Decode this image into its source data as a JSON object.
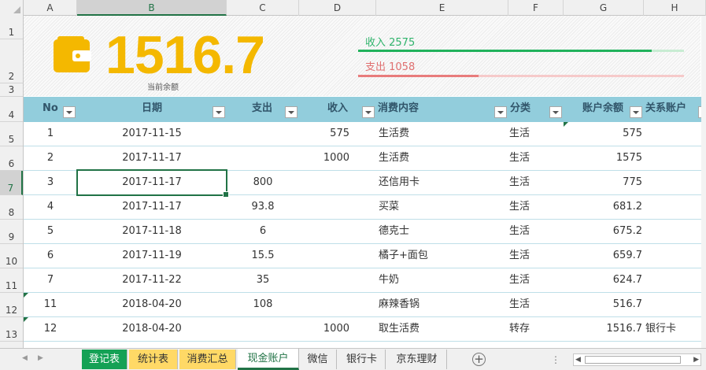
{
  "column_headers": [
    "A",
    "B",
    "C",
    "D",
    "E",
    "F",
    "G",
    "H"
  ],
  "row_headers": [
    "1",
    "2",
    "3",
    "4",
    "5",
    "6",
    "7",
    "8",
    "9",
    "10",
    "11",
    "12",
    "13"
  ],
  "dashboard": {
    "balance": "1516.7",
    "balance_label": "当前余额",
    "income_label": "收入 2575",
    "income_fraction": 0.9,
    "expense_label": "支出 1058",
    "expense_fraction": 0.37,
    "income_color": "#21b25c",
    "expense_color": "#e87c7c",
    "balance_color": "#f4b800"
  },
  "table": {
    "headers": [
      "No",
      "日期",
      "支出",
      "收入",
      "消费内容",
      "分类",
      "账户余额",
      "关系账户"
    ],
    "header_color": "#92cddc",
    "rows": [
      {
        "no": "1",
        "date": "2017-11-15",
        "expense": "",
        "income": "575",
        "content": "生活费",
        "category": "生活",
        "balance": "575",
        "account": ""
      },
      {
        "no": "2",
        "date": "2017-11-17",
        "expense": "",
        "income": "1000",
        "content": "生活费",
        "category": "生活",
        "balance": "1575",
        "account": ""
      },
      {
        "no": "3",
        "date": "2017-11-17",
        "expense": "800",
        "income": "",
        "content": "还信用卡",
        "category": "生活",
        "balance": "775",
        "account": ""
      },
      {
        "no": "4",
        "date": "2017-11-17",
        "expense": "93.8",
        "income": "",
        "content": "买菜",
        "category": "生活",
        "balance": "681.2",
        "account": ""
      },
      {
        "no": "5",
        "date": "2017-11-18",
        "expense": "6",
        "income": "",
        "content": "德克士",
        "category": "生活",
        "balance": "675.2",
        "account": ""
      },
      {
        "no": "6",
        "date": "2017-11-19",
        "expense": "15.5",
        "income": "",
        "content": "橘子+面包",
        "category": "生活",
        "balance": "659.7",
        "account": ""
      },
      {
        "no": "7",
        "date": "2017-11-22",
        "expense": "35",
        "income": "",
        "content": "牛奶",
        "category": "生活",
        "balance": "624.7",
        "account": ""
      },
      {
        "no": "11",
        "date": "2018-04-20",
        "expense": "108",
        "income": "",
        "content": "麻辣香锅",
        "category": "生活",
        "balance": "516.7",
        "account": ""
      },
      {
        "no": "12",
        "date": "2018-04-20",
        "expense": "",
        "income": "1000",
        "content": "取生活费",
        "category": "转存",
        "balance": "1516.7",
        "account": "银行卡"
      }
    ]
  },
  "sheet_tabs": [
    "登记表",
    "统计表",
    "消费汇总",
    "现金账户",
    "微信",
    "银行卡",
    "京东理财"
  ],
  "active_tab": "现金账户",
  "icons": {
    "wallet": "wallet-icon",
    "add_sheet": "plus-circle-icon",
    "filter": "filter-dropdown-icon"
  }
}
